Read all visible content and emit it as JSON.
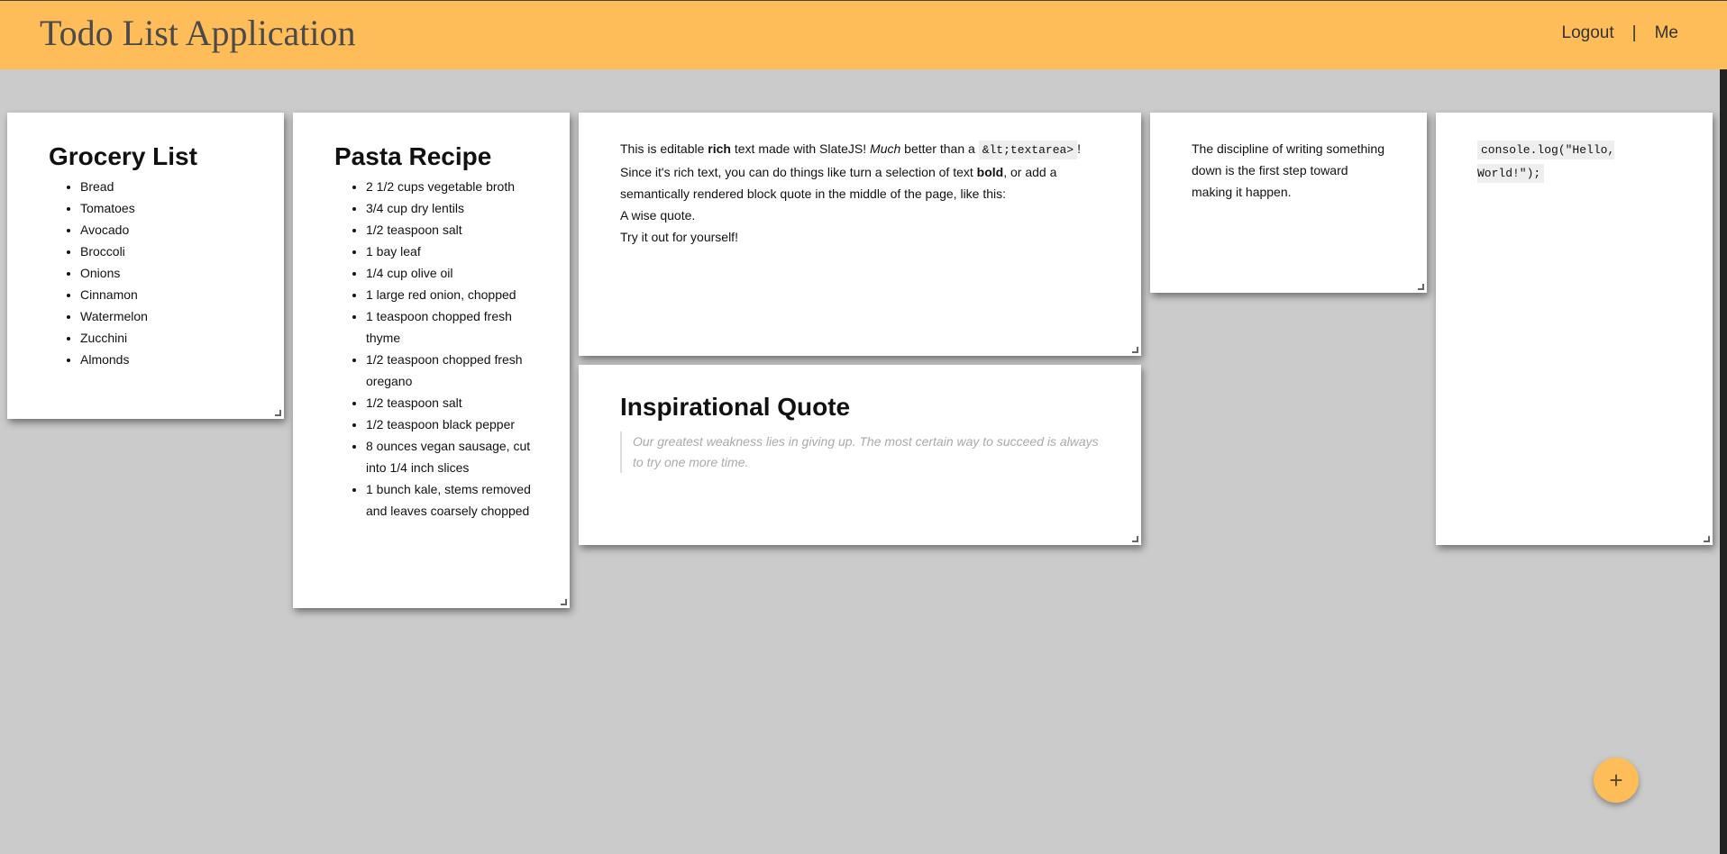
{
  "header": {
    "title": "Todo List Application",
    "nav": {
      "logout": "Logout",
      "separator": "|",
      "me": "Me"
    },
    "background": "#ffbd59"
  },
  "notes": {
    "grocery": {
      "title": "Grocery List",
      "items": [
        "Bread",
        "Tomatoes",
        "Avocado",
        "Broccoli",
        "Onions",
        "Cinnamon",
        "Watermelon",
        "Zucchini",
        "Almonds"
      ]
    },
    "pasta": {
      "title": "Pasta Recipe",
      "items": [
        "2 1/2 cups vegetable broth",
        " 3/4 cup dry lentils",
        "1/2 teaspoon salt",
        "1 bay leaf",
        "1/4 cup olive oil",
        "1 large red onion, chopped",
        "1 teaspoon chopped fresh thyme",
        "1/2 teaspoon chopped fresh oregano",
        "1/2 teaspoon salt",
        "1/2 teaspoon black pepper",
        "8 ounces vegan sausage, cut into 1/4 inch slices",
        "1 bunch kale, stems removed and leaves coarsely chopped"
      ]
    },
    "rich": {
      "t1": "This is editable ",
      "rich": "rich",
      "t2": " text made with SlateJS! ",
      "much": "Much",
      "t3": " better than a ",
      "code": "&lt;textarea>",
      "t4": "!",
      "t5": "Since it's rich text, you can do things like turn a selection of text ",
      "bold": "bold",
      "t6": ", or add a semantically rendered block quote in the middle of the page, like this:",
      "line3": "A wise quote.",
      "line4": "Try it out for yourself!"
    },
    "discipline": {
      "text": "The discipline of writing something down is the first step toward making it happen."
    },
    "code": {
      "text": "console.log(\"Hello, World!\");"
    },
    "quote": {
      "title": "Inspirational Quote",
      "text": "Our greatest weakness lies in giving up. The most certain way to succeed is always to try one more time."
    }
  },
  "fab": {
    "label": "+"
  }
}
